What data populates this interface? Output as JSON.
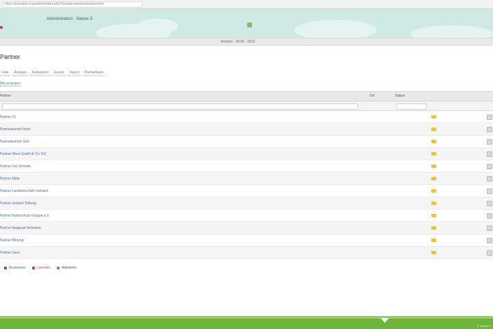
{
  "browser": {
    "url": "https://example.org/admin/index.php?module=partner&action=list"
  },
  "header": {
    "site_title": "Administration · Nature-S"
  },
  "status": {
    "text": "Session · 00:00 · 2013"
  },
  "page": {
    "title": "Partner"
  },
  "tabs": [
    {
      "label": "Liste"
    },
    {
      "label": "Anlegen"
    },
    {
      "label": "Kategorien"
    },
    {
      "label": "Export"
    },
    {
      "label": "Import"
    },
    {
      "label": "Partnerkarte"
    }
  ],
  "sublink": {
    "label": "Alle anzeigen"
  },
  "table": {
    "columns": {
      "name": "Partner",
      "ort": "Ort",
      "status": "Status"
    },
    "rows": [
      {
        "name": "Partner 01"
      },
      {
        "name": "Partnerbetrieb Nord"
      },
      {
        "name": "Partnerbetrieb Süd"
      },
      {
        "name": "Partner West GmbH & Co. KG"
      },
      {
        "name": "Partner Ost Zentrale"
      },
      {
        "name": "Partner Mitte"
      },
      {
        "name": "Partner Landwirtschaft Verband"
      },
      {
        "name": "Partner Umwelt Stiftung"
      },
      {
        "name": "Partner Naturschutz Gruppe e.V."
      },
      {
        "name": "Partner Regional Netzwerk"
      },
      {
        "name": "Partner Bildung"
      },
      {
        "name": "Partner Gast"
      }
    ]
  },
  "actions": [
    {
      "label": "Bearbeiten",
      "color": "#4a6fa5"
    },
    {
      "label": "Löschen",
      "color": "#d04040"
    },
    {
      "label": "Aktivieren",
      "color": "#6aa84f"
    }
  ],
  "footer": {
    "copyright": "© Nature-S"
  }
}
